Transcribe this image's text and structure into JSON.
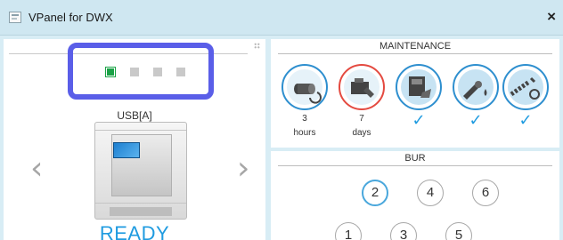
{
  "window": {
    "title": "VPanel for DWX",
    "close_glyph": "×"
  },
  "device_panel": {
    "indicators": [
      {
        "state": "active"
      },
      {
        "state": "inactive"
      },
      {
        "state": "inactive"
      },
      {
        "state": "inactive"
      }
    ],
    "device_label": "USB[A]",
    "status": "READY",
    "nav": {
      "prev_glyph": "‹",
      "next_glyph": "›"
    },
    "colors": {
      "highlight": "#5a5ee8",
      "status": "#1f9be0",
      "active_indicator": "#1aa246"
    }
  },
  "maintenance": {
    "title": "MAINTENANCE",
    "items": [
      {
        "icon": "dust-collector-roller-icon",
        "value": "3",
        "unit": "hours",
        "ring": "normal"
      },
      {
        "icon": "spindle-motor-icon",
        "value": "7",
        "unit": "days",
        "ring": "warning"
      },
      {
        "icon": "cleaning-manual-icon",
        "check": "✓",
        "ring": "full"
      },
      {
        "icon": "air-cleaning-icon",
        "check": "✓",
        "ring": "full"
      },
      {
        "icon": "clamp-cleaning-icon",
        "check": "✓",
        "ring": "full"
      }
    ]
  },
  "bur": {
    "title": "BUR",
    "rows": [
      [
        "2",
        "4",
        "6"
      ],
      [
        "1",
        "3",
        "5"
      ]
    ],
    "selected": "2"
  }
}
